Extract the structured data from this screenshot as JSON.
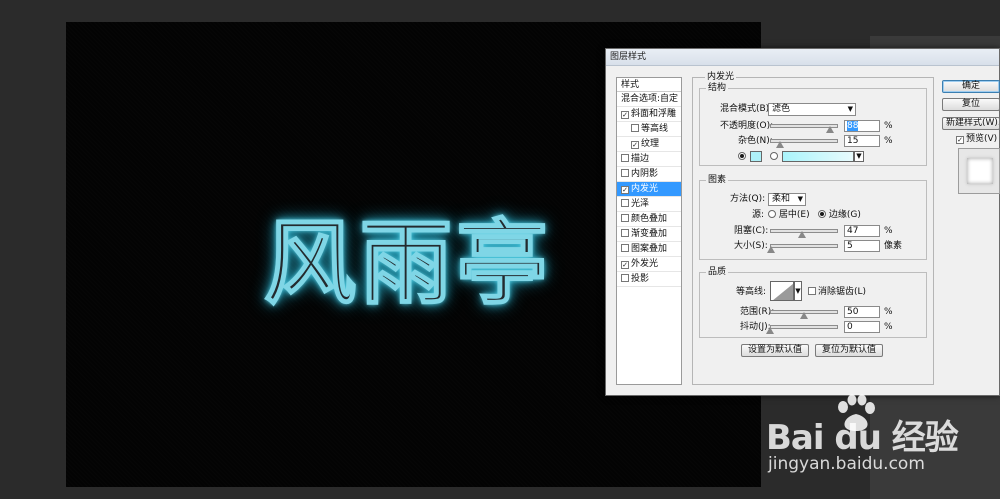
{
  "canvas": {
    "text": "风雨亭",
    "glow_color": "#6fe3f5"
  },
  "dialog": {
    "title": "图层样式",
    "styles_panel": {
      "header": "样式",
      "items": [
        {
          "label": "混合选项:自定",
          "checked": null,
          "sub": false,
          "active": false
        },
        {
          "label": "斜面和浮雕",
          "checked": true,
          "sub": false,
          "active": false
        },
        {
          "label": "等高线",
          "checked": false,
          "sub": true,
          "active": false
        },
        {
          "label": "纹理",
          "checked": true,
          "sub": true,
          "active": false
        },
        {
          "label": "描边",
          "checked": false,
          "sub": false,
          "active": false
        },
        {
          "label": "内阴影",
          "checked": false,
          "sub": false,
          "active": false
        },
        {
          "label": "内发光",
          "checked": true,
          "sub": false,
          "active": true
        },
        {
          "label": "光泽",
          "checked": false,
          "sub": false,
          "active": false
        },
        {
          "label": "颜色叠加",
          "checked": false,
          "sub": false,
          "active": false
        },
        {
          "label": "渐变叠加",
          "checked": false,
          "sub": false,
          "active": false
        },
        {
          "label": "图案叠加",
          "checked": false,
          "sub": false,
          "active": false
        },
        {
          "label": "外发光",
          "checked": true,
          "sub": false,
          "active": false
        },
        {
          "label": "投影",
          "checked": false,
          "sub": false,
          "active": false
        }
      ]
    },
    "inner_glow": {
      "group_title": "内发光",
      "structure": {
        "title": "结构",
        "blend_mode_label": "混合模式(B):",
        "blend_mode_value": "滤色",
        "opacity_label": "不透明度(O):",
        "opacity_value": "88",
        "opacity_fraction": 0.88,
        "noise_label": "杂色(N):",
        "noise_value": "15",
        "noise_fraction": 0.15,
        "percent": "%",
        "swatch_color": "#aef1f8"
      },
      "elements": {
        "title": "图素",
        "technique_label": "方法(Q):",
        "technique_value": "柔和",
        "source_label": "源:",
        "source_center": "居中(E)",
        "source_edge": "边缘(G)",
        "choke_label": "阻塞(C):",
        "choke_value": "47",
        "choke_fraction": 0.47,
        "size_label": "大小(S):",
        "size_value": "5",
        "size_fraction": 0.02,
        "percent": "%",
        "pixels": "像素"
      },
      "quality": {
        "title": "品质",
        "contour_label": "等高线:",
        "antialias_label": "消除锯齿(L)",
        "range_label": "范围(R):",
        "range_value": "50",
        "range_fraction": 0.5,
        "jitter_label": "抖动(J):",
        "jitter_value": "0",
        "jitter_fraction": 0.0,
        "percent": "%"
      },
      "make_default": "设置为默认值",
      "reset_default": "复位为默认值"
    },
    "buttons": {
      "ok": "确定",
      "reset": "复位",
      "new_style": "新建样式(W)...",
      "preview": "预览(V)"
    }
  },
  "watermark": {
    "text": "Bai du 经验",
    "url": "jingyan.baidu.com"
  }
}
